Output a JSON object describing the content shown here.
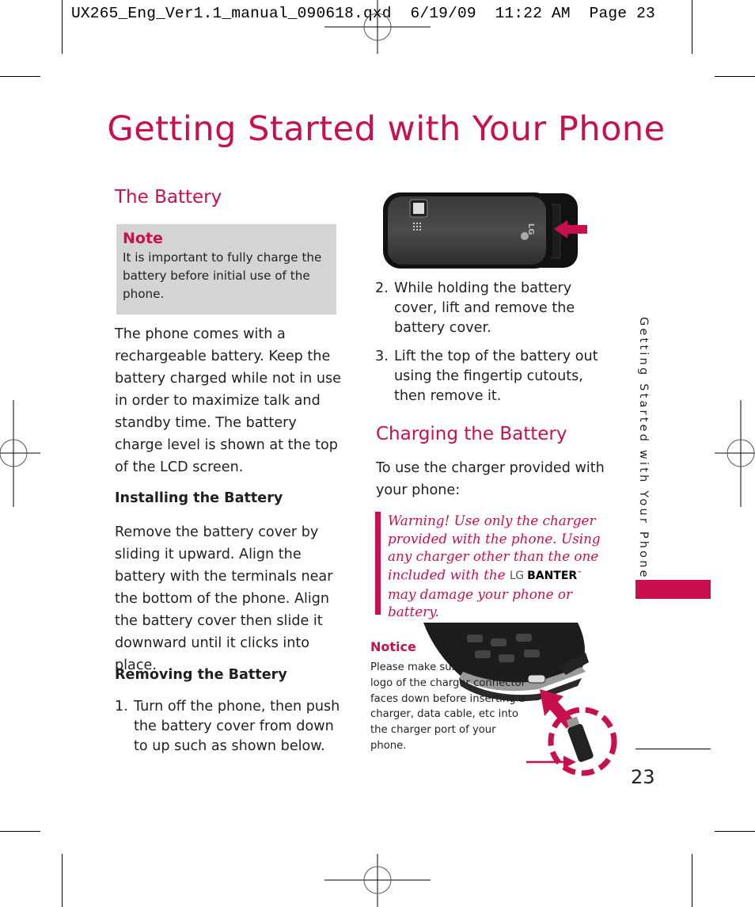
{
  "slug": "UX265_Eng_Ver1.1_manual_090618.qxd  6/19/09  11:22 AM  Page 23",
  "page": {
    "title": "Getting Started with Your Phone",
    "side_tab": "Getting Started with Your Phone",
    "page_number": "23",
    "accent_color": "#c8104e"
  },
  "left": {
    "heading": "The Battery",
    "note": {
      "label": "Note",
      "text": "It is important to fully charge the battery before initial use of the phone."
    },
    "intro": "The phone comes with a rechargeable battery. Keep the battery charged while not in use in order to maximize talk and standby time. The battery charge level is shown at the top of the LCD screen.",
    "installing": {
      "heading": "Installing the Battery",
      "text": "Remove the battery cover by sliding it upward. Align the battery with the terminals near the bottom of the phone. Align the battery cover then slide it downward until it clicks into place."
    },
    "removing": {
      "heading": "Removing the Battery",
      "steps": [
        {
          "num": "1.",
          "text": "Turn off the phone, then push the battery cover from down to up such as shown below."
        }
      ]
    }
  },
  "right": {
    "figure_battery": {
      "icon": "phone-back-battery-cover-image",
      "arrow": "arrow-left-icon",
      "logo_text": "LG"
    },
    "steps": [
      {
        "num": "2.",
        "text": "While holding the battery cover, lift and remove the battery cover."
      },
      {
        "num": "3.",
        "text": "Lift the top of the battery out using the fingertip cutouts, then remove it."
      }
    ],
    "charging": {
      "heading": "Charging the Battery",
      "intro": "To use the charger provided with your phone:",
      "warning_before": "Warning! Use only the charger provided with the phone. Using any charger other than the one included with the",
      "brand_lg": "LG",
      "brand_name": "BANTER",
      "brand_tm": "™",
      "warning_after": "may damage your phone or battery."
    },
    "notice": {
      "label": "Notice",
      "text": "Please make sure that the LG logo of the charger connector faces down before inserting a charger, data cable, etc into the charger port of your phone.",
      "figure": "phone-charger-port-image"
    }
  }
}
